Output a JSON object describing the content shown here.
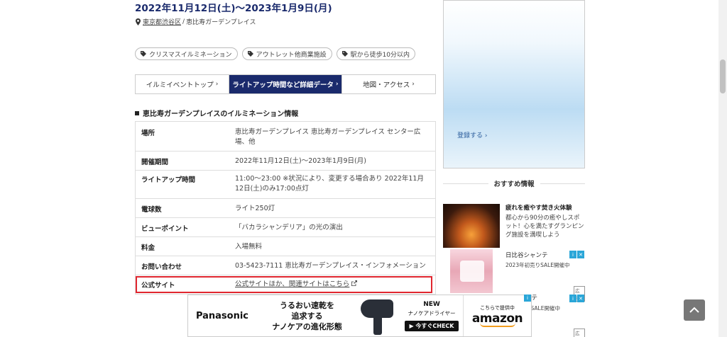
{
  "event": {
    "dates": "2022年11月12日(土)〜2023年1月9日(月)",
    "location_pref": "東京都渋谷区",
    "location_sep": " / ",
    "location_place": "恵比寿ガーデンプレイス"
  },
  "tags": [
    {
      "label": "クリスマスイルミネーション"
    },
    {
      "label": "アウトレット他商業施設"
    },
    {
      "label": "駅から徒歩10分以内"
    }
  ],
  "tabs": [
    {
      "label": "イルミイベントトップ",
      "active": false
    },
    {
      "label": "ライトアップ時間など詳細データ",
      "active": true
    },
    {
      "label": "地図・アクセス",
      "active": false
    }
  ],
  "section_title": "恵比寿ガーデンプレイスのイルミネーション情報",
  "info": {
    "place": {
      "label": "場所",
      "value": "恵比寿ガーデンプレイス 恵比寿ガーデンプレイス センター広場、他"
    },
    "period": {
      "label": "開催期間",
      "value": "2022年11月12日(土)〜2023年1月9日(月)"
    },
    "lightup": {
      "label": "ライトアップ時間",
      "value": "11:00〜23:00 ※状況により、変更する場合あり 2022年11月12日(土)のみ17:00点灯"
    },
    "bulbs": {
      "label": "電球数",
      "value": "ライト250灯"
    },
    "viewpoint": {
      "label": "ビューポイント",
      "value": "「バカラシャンデリア」の光の演出"
    },
    "fee": {
      "label": "料金",
      "value": "入場無料"
    },
    "contact": {
      "label": "お問い合わせ",
      "value": "03-5423-7111 恵比寿ガーデンプレイス・インフォメーション"
    },
    "site": {
      "label": "公式サイト",
      "value": "公式サイトほか、関連サイトはこちら"
    }
  },
  "sidebar": {
    "register": "登録する",
    "reco_title": "おすすめ情報",
    "reco1": {
      "title": "疲れを癒やす焚き火体験",
      "desc": "都心から90分の癒やしスポット！心を満たすグランピング施設を満喫しよう"
    },
    "reco2": {
      "store": "日比谷シャンテ",
      "sale": "2023年初売りSALE開催中"
    },
    "reco3": {
      "store": "ンテ",
      "sale": "りSALE開催中"
    },
    "ad_label": "広告"
  },
  "banner": {
    "brand": "Panasonic",
    "copy_line1": "うるおい速乾を",
    "copy_line2": "追求する",
    "copy_line3": "ナノケアの進化形態",
    "new": "NEW",
    "product": "ナノケアドライヤー",
    "cta": "▶ 今すぐCHECK",
    "provided": "こちらで提供中",
    "amazon": "amazon"
  },
  "colors": {
    "accent": "#1a2a6c",
    "highlight": "#e0262f"
  }
}
